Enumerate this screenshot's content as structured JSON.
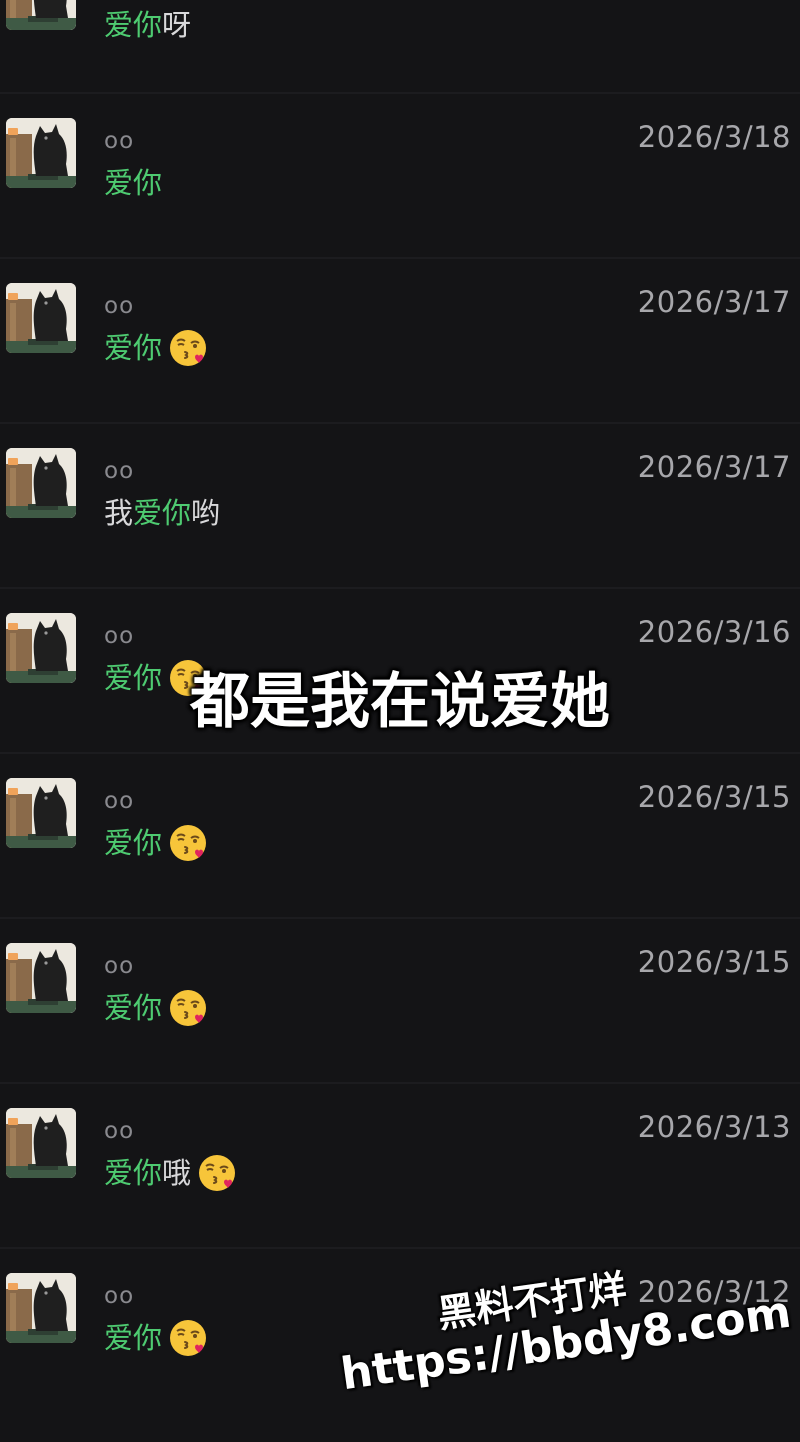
{
  "messages": [
    {
      "name": "",
      "date": "",
      "parts": [
        {
          "text": "爱你",
          "kw": true
        },
        {
          "text": "呀",
          "kw": false
        }
      ],
      "emoji": null
    },
    {
      "name": "oo",
      "date": "2026/3/18",
      "parts": [
        {
          "text": "爱你",
          "kw": true
        }
      ],
      "emoji": null
    },
    {
      "name": "oo",
      "date": "2026/3/17",
      "parts": [
        {
          "text": "爱你",
          "kw": true
        }
      ],
      "emoji": "kissing-heart-emoji"
    },
    {
      "name": "oo",
      "date": "2026/3/17",
      "parts": [
        {
          "text": "我",
          "kw": false
        },
        {
          "text": "爱你",
          "kw": true
        },
        {
          "text": "哟",
          "kw": false
        }
      ],
      "emoji": null
    },
    {
      "name": "oo",
      "date": "2026/3/16",
      "parts": [
        {
          "text": "爱你",
          "kw": true
        }
      ],
      "emoji": "kissing-heart-emoji"
    },
    {
      "name": "oo",
      "date": "2026/3/15",
      "parts": [
        {
          "text": "爱你",
          "kw": true
        }
      ],
      "emoji": "kissing-heart-emoji"
    },
    {
      "name": "oo",
      "date": "2026/3/15",
      "parts": [
        {
          "text": "爱你",
          "kw": true
        }
      ],
      "emoji": "kissing-heart-emoji"
    },
    {
      "name": "oo",
      "date": "2026/3/13",
      "parts": [
        {
          "text": "爱你",
          "kw": true
        },
        {
          "text": "哦",
          "kw": false
        }
      ],
      "emoji": "kissing-heart-emoji"
    },
    {
      "name": "oo",
      "date": "2026/3/12",
      "parts": [
        {
          "text": "爱你",
          "kw": true
        }
      ],
      "emoji": "kissing-heart-emoji"
    }
  ],
  "overlay_caption": "都是我在说爱她",
  "watermark": {
    "line1": "黑料不打烊",
    "line2": "https://bbdy8.com"
  },
  "colors": {
    "background": "#141416",
    "keyword": "#4ecb71",
    "text": "#d8d8da",
    "name": "#8a8a8f",
    "date": "#a7a7ab"
  }
}
